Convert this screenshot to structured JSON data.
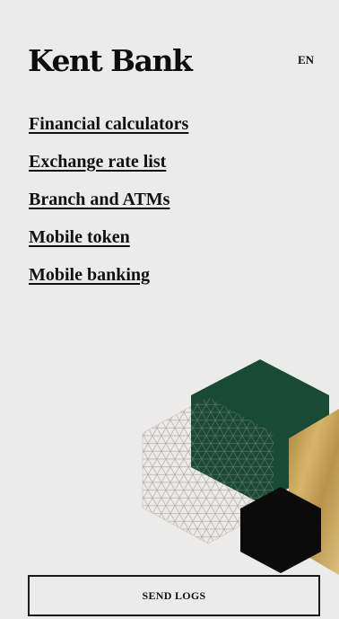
{
  "brand": {
    "name": "Kent Bank"
  },
  "header": {
    "language": "EN"
  },
  "menu": {
    "items": [
      {
        "label": "Financial calculators"
      },
      {
        "label": "Exchange rate list"
      },
      {
        "label": "Branch and ATMs"
      },
      {
        "label": "Mobile token"
      },
      {
        "label": "Mobile banking"
      }
    ]
  },
  "footer": {
    "send_logs_label": "SEND LOGS"
  },
  "colors": {
    "background": "#ebebeb",
    "text": "#111111",
    "hex_green": "#184a35",
    "hex_gold": "#c9a45c",
    "hex_black": "#0b0b0b",
    "hex_lattice": "#b7aea4"
  },
  "decorative": {
    "art_name": "hexagon-pattern"
  }
}
